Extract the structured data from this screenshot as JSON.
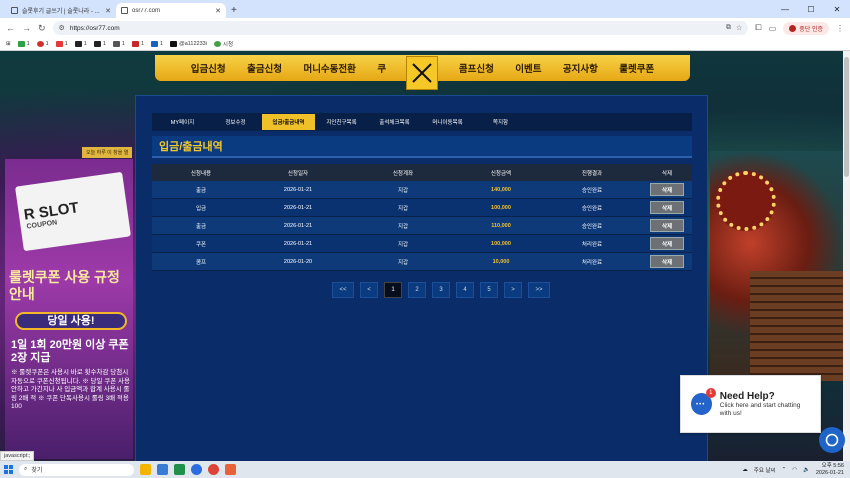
{
  "browser": {
    "tabs": [
      {
        "title": "슬롯후기 글쓰기 | 슬롯나라 - ..."
      },
      {
        "title": "osr77.com"
      }
    ],
    "new_tab": "+",
    "url": "https://osr77.com",
    "profile_label": "중단 인증",
    "bookmarks": [
      "1",
      "1",
      "1",
      "1",
      "1",
      "1",
      "1",
      "1",
      "@a112233i",
      "시청"
    ],
    "status_text": "javascript:;"
  },
  "site": {
    "nav": [
      "입금신청",
      "출금신청",
      "머니수동전환",
      "쿠",
      "콤프신청",
      "이벤트",
      "공지사항",
      "룰렛쿠폰"
    ],
    "promo": {
      "top_tag": "오늘 하루 이 창을 열",
      "coupon_line1": "R SLOT",
      "coupon_line2": "COUPON",
      "heading": "룰렛쿠폰 사용 규정 안내",
      "badge": "당일 사용!",
      "line": "1일 1회 20만원 이상 쿠폰 2장 지급",
      "notes": "※ 룰렛쿠폰은 사용시 바로 횟수차감 당첨시 자동으로 쿠폰신청됩니다. ※ 당일 쿠폰 사용안하고 가긴지나 사 입금액과 합계 사용시 롤링 2배 적 ※ 쿠폰 단독사용시 롤링 3배 적용 100"
    },
    "panel": {
      "tabs": [
        "MY페이지",
        "정보수정",
        "입금/출금내역",
        "지인친구목록",
        "출석체크목록",
        "머니이동목록",
        "쪽지함"
      ],
      "active_tab": 2,
      "section_title": "입금/출금내역",
      "columns": [
        "신청내용",
        "신청일자",
        "신청계좌",
        "신청금액",
        "진행결과",
        "삭제"
      ],
      "rows": [
        {
          "type": "출금",
          "date": "2026-01-21",
          "account": "지갑",
          "amount": "140,000",
          "result": "승인완료",
          "action": "삭제"
        },
        {
          "type": "입금",
          "date": "2026-01-21",
          "account": "지갑",
          "amount": "100,000",
          "result": "승인완료",
          "action": "삭제"
        },
        {
          "type": "출금",
          "date": "2026-01-21",
          "account": "지갑",
          "amount": "110,000",
          "result": "승인완료",
          "action": "삭제"
        },
        {
          "type": "쿠폰",
          "date": "2026-01-21",
          "account": "지갑",
          "amount": "100,000",
          "result": "처리완료",
          "action": "삭제"
        },
        {
          "type": "콤프",
          "date": "2026-01-20",
          "account": "지갑",
          "amount": "10,000",
          "result": "처리완료",
          "action": "삭제"
        }
      ],
      "pagination": [
        "<<",
        "<",
        "1",
        "2",
        "3",
        "4",
        "5",
        ">",
        ">>"
      ],
      "current_page": "1"
    },
    "help": {
      "badge": "1",
      "title": "Need Help?",
      "text": "Click here and start chatting with us!"
    }
  },
  "taskbar": {
    "search_placeholder": "찾기",
    "weather": "주요 날씨",
    "time": "오후 5:56",
    "date": "2026-01-21"
  }
}
